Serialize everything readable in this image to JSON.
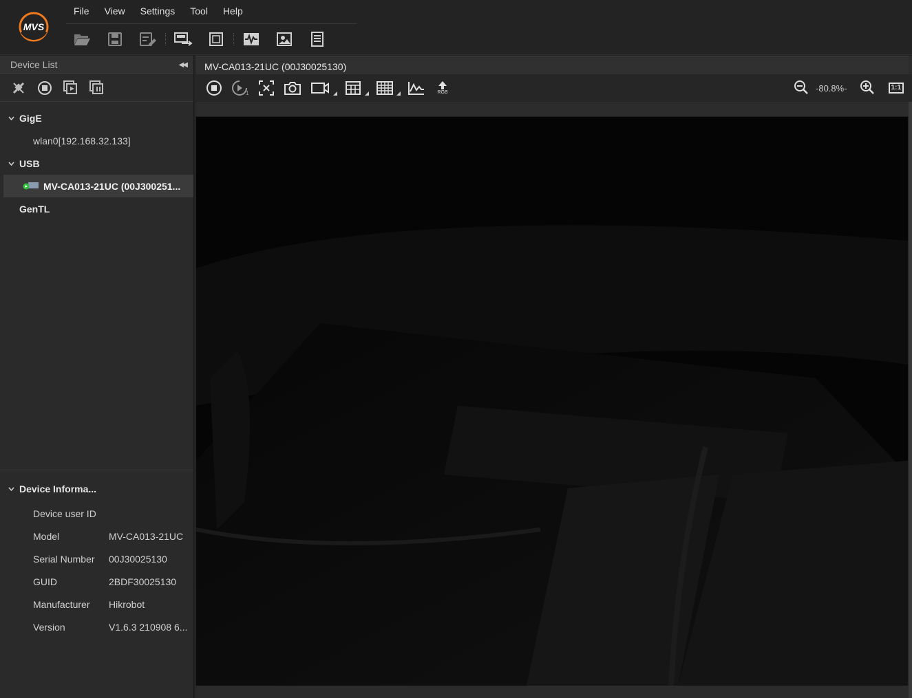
{
  "menu": [
    "File",
    "View",
    "Settings",
    "Tool",
    "Help"
  ],
  "logo_text": "MVS",
  "device_list": {
    "title": "Device List",
    "groups": [
      {
        "label": "GigE",
        "items": [
          "wlan0[192.168.32.133]"
        ]
      },
      {
        "label": "USB",
        "device": "MV-CA013-21UC (00J300251..."
      },
      {
        "label": "GenTL"
      }
    ]
  },
  "device_info": {
    "title": "Device Informa...",
    "rows": [
      {
        "key": "Device user ID",
        "value": ""
      },
      {
        "key": "Model",
        "value": "MV-CA013-21UC"
      },
      {
        "key": "Serial Number",
        "value": "00J30025130"
      },
      {
        "key": "GUID",
        "value": "2BDF30025130"
      },
      {
        "key": "Manufacturer",
        "value": "Hikrobot"
      },
      {
        "key": "Version",
        "value": "V1.6.3 210908 6..."
      }
    ]
  },
  "viewer": {
    "tab_title": "MV-CA013-21UC (00J30025130)",
    "rgb_label": "RGB",
    "zoom": "-80.8%-",
    "one_to_one": "1:1"
  },
  "colors": {
    "accent_orange": "#f07a1e",
    "status_green": "#2fbf3a"
  }
}
